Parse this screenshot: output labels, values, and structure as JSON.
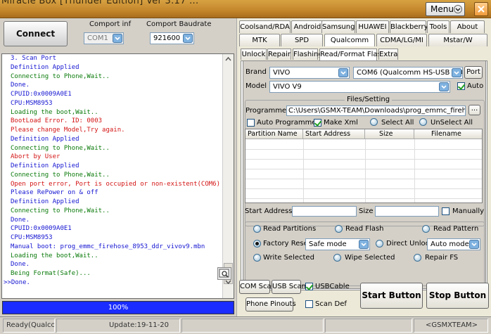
{
  "window": {
    "title": "Miracle Box [Thunder Edition] Ver 3.17 ...",
    "menu_label": "Menu"
  },
  "left": {
    "connect_label": "Connect Button",
    "comport_label": "Comport inf",
    "comport_value": "COM1",
    "baud_label": "Comport Baudrate",
    "baud_value": "921600",
    "progress_text": "100%",
    "progress_value": 100,
    "log": [
      {
        "text": "3. Scan Port",
        "color": "#1414d2"
      },
      {
        "text": "Definition Applied",
        "color": "#1414d2"
      },
      {
        "text": "Connecting to Phone,Wait..",
        "color": "#0a7a0a"
      },
      {
        "text": "Done.",
        "color": "#1414d2"
      },
      {
        "text": "CPUID:0x0009A0E1",
        "color": "#1414d2"
      },
      {
        "text": "CPU:MSM8953",
        "color": "#1414d2"
      },
      {
        "text": "Loading the boot,Wait..",
        "color": "#0a7a0a"
      },
      {
        "text": "BootLoad Error. ID: 0003",
        "color": "#d41414"
      },
      {
        "text": "Please change Model,Try again.",
        "color": "#d41414"
      },
      {
        "text": "Definition Applied",
        "color": "#1414d2"
      },
      {
        "text": "Connecting to Phone,Wait..",
        "color": "#0a7a0a"
      },
      {
        "text": "Abort by User",
        "color": "#d41414"
      },
      {
        "text": "Definition Applied",
        "color": "#1414d2"
      },
      {
        "text": "Connecting to Phone,Wait..",
        "color": "#0a7a0a"
      },
      {
        "text": "Open port error, Port is occupied or non-existent(COM6)",
        "color": "#d41414"
      },
      {
        "text": "Please RePower on & off",
        "color": "#1414d2"
      },
      {
        "text": "Definition Applied",
        "color": "#1414d2"
      },
      {
        "text": "Connecting to Phone,Wait..",
        "color": "#0a7a0a"
      },
      {
        "text": "Done.",
        "color": "#1414d2"
      },
      {
        "text": "CPUID:0x0009A0E1",
        "color": "#1414d2"
      },
      {
        "text": "CPU:MSM8953",
        "color": "#1414d2"
      },
      {
        "text": "Manual boot: prog_emmc_firehose_8953_ddr_vivov9.mbn",
        "color": "#1414d2"
      },
      {
        "text": "Loading the boot,Wait..",
        "color": "#0a7a0a"
      },
      {
        "text": "Done.",
        "color": "#1414d2"
      },
      {
        "text": "Being Format(Safe)...",
        "color": "#0a7a0a"
      },
      {
        "text": ">>Done.",
        "color": "#1414d2"
      }
    ]
  },
  "tabs_row1": [
    "Coolsand/RDA",
    "Android",
    "Samsung",
    "HUAWEI",
    "Blackberry",
    "Tools",
    "About"
  ],
  "tabs_row2": [
    "MTK",
    "SPD",
    "Qualcomm",
    "CDMA/LG/MI",
    "Mstar/W"
  ],
  "subtabs": [
    "Unlock",
    "Repair",
    "Flashing",
    "Read/Format Flash",
    "Extra"
  ],
  "form": {
    "brand_label": "Brand :",
    "brand_value": "VIVO",
    "port_value": "COM6 (Qualcomm HS-USB QDLoad",
    "port_button": "Port",
    "model_label": "Model :",
    "model_value": "VIVO V9",
    "auto_label": "Auto",
    "files_legend": "Files/Setting",
    "programmer_label": "Programmer:",
    "programmer_value": "C:\\Users\\GSMX-TEAM\\Downloads\\prog_emmc_firehose_8953_d",
    "browse_label": "...",
    "auto_programmer_label": "Auto Programmer",
    "make_xml_label": "Make Xml",
    "select_all_label": "Select All",
    "unselect_all_label": "UnSelect All",
    "columns": [
      "Partition Name",
      "Start Address",
      "Size",
      "Filename"
    ],
    "start_address_label": "Start Address(0x)",
    "size_label": "Size :",
    "manually_label": "Manually"
  },
  "options": {
    "read_partitions": "Read Partitions",
    "read_flash": "Read Flash",
    "read_pattern": "Read Pattern",
    "factory_reset": "Factory Reset",
    "factory_reset_mode": "Safe mode",
    "direct_unlock": "Direct Unlock",
    "direct_unlock_mode": "Auto mode",
    "write_selected": "Write Selected",
    "wipe_selected": "Wipe Selected",
    "repair_fs": "Repair FS"
  },
  "bottom": {
    "com_scan": "COM Scan",
    "usb_scan": "USB Scan",
    "usb_cable": "USBCable",
    "phone_pinouts": "Phone Pinouts",
    "scan_def": "Scan Def",
    "start_button": "Start Button",
    "stop_button": "Stop Button"
  },
  "statusbar": {
    "ready": "Ready(Qualco...",
    "update": "Update:19-11-20",
    "team": "<GSMXTEAM>"
  },
  "colors": {
    "progress": "#1a2cff",
    "titlebar": "#c4862a"
  }
}
